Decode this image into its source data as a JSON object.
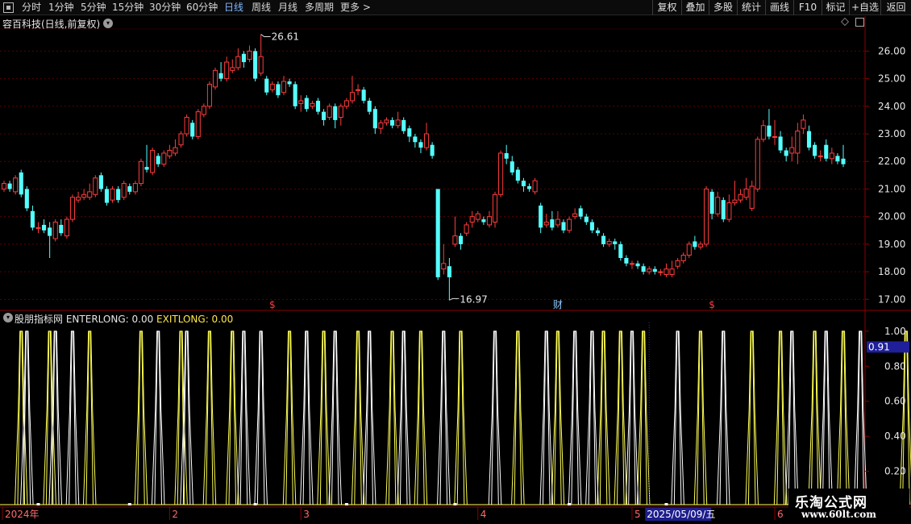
{
  "toolbar": {
    "tabs": [
      "分时",
      "1分钟",
      "5分钟",
      "15分钟",
      "30分钟",
      "60分钟",
      "日线",
      "周线",
      "月线",
      "多周期",
      "更多 >"
    ],
    "active_tab": "日线",
    "buttons": [
      "复权",
      "叠加",
      "多股",
      "统计",
      "画线",
      "F10",
      "标记",
      "+自选",
      "返回"
    ]
  },
  "main_chart": {
    "title": "容百科技(日线,前复权)",
    "y_ticks": [
      "26.00",
      "25.00",
      "24.00",
      "23.00",
      "22.00",
      "21.00",
      "20.00",
      "19.00",
      "18.00",
      "17.00"
    ],
    "high_label": "26.61",
    "low_label": "16.97",
    "markers": [
      "$",
      "财",
      "$"
    ]
  },
  "indicator": {
    "name": "股朋指标网",
    "enterlong": "ENTERLONG: 0.00",
    "exitlong": "EXITLONG: 0.00",
    "y_ticks": [
      "1.00",
      "0.80",
      "0.60",
      "0.40",
      "0.20"
    ],
    "current_value": "0.91"
  },
  "date_axis": {
    "labels": [
      "2024年",
      "2",
      "3",
      "4",
      "5",
      "6"
    ],
    "highlight": "2025/05/09/五"
  },
  "colors": {
    "up": "#ff3c3c",
    "down": "#54ffff",
    "enter": "#ffff55",
    "exit": "#ffffff",
    "grid": "#5a0000",
    "panel_border": "#8b0000"
  },
  "watermark": {
    "line1": "乐淘公式网",
    "line2": "www.60lt.com"
  },
  "chart_data": [
    {
      "type": "candlestick",
      "title": "容百科技(日线,前复权)",
      "ylim": [
        16.6,
        26.8
      ],
      "candles": [
        [
          21.0,
          21.2,
          21.3,
          20.9
        ],
        [
          21.2,
          21.0,
          21.3,
          20.9
        ],
        [
          20.9,
          21.4,
          21.5,
          20.8
        ],
        [
          21.6,
          20.8,
          21.7,
          20.7
        ],
        [
          21.0,
          20.3,
          21.1,
          20.2
        ],
        [
          20.2,
          19.6,
          20.4,
          19.5
        ],
        [
          19.6,
          19.6,
          19.8,
          19.4
        ],
        [
          19.7,
          19.5,
          19.9,
          19.4
        ],
        [
          19.6,
          19.3,
          19.8,
          18.5
        ],
        [
          19.2,
          19.8,
          19.9,
          19.1
        ],
        [
          19.7,
          19.4,
          19.9,
          19.3
        ],
        [
          19.3,
          19.9,
          20.0,
          19.2
        ],
        [
          19.9,
          20.7,
          20.8,
          19.8
        ],
        [
          20.6,
          20.7,
          20.9,
          20.5
        ],
        [
          20.7,
          20.8,
          21.0,
          20.6
        ],
        [
          20.7,
          20.9,
          21.2,
          20.6
        ],
        [
          20.8,
          21.4,
          21.5,
          20.7
        ],
        [
          21.5,
          21.0,
          21.6,
          20.9
        ],
        [
          21.0,
          20.5,
          21.1,
          20.4
        ],
        [
          20.6,
          21.0,
          21.1,
          20.5
        ],
        [
          21.0,
          20.6,
          21.1,
          20.5
        ],
        [
          20.7,
          21.2,
          21.3,
          20.6
        ],
        [
          21.1,
          20.9,
          21.2,
          20.8
        ],
        [
          20.9,
          21.2,
          21.3,
          20.8
        ],
        [
          21.2,
          22.0,
          22.1,
          21.1
        ],
        [
          21.8,
          21.7,
          22.6,
          21.6
        ],
        [
          21.6,
          22.4,
          22.5,
          21.5
        ],
        [
          22.2,
          21.9,
          22.3,
          21.8
        ],
        [
          21.9,
          22.3,
          22.4,
          21.8
        ],
        [
          22.2,
          22.4,
          22.6,
          22.1
        ],
        [
          22.3,
          22.5,
          22.8,
          22.2
        ],
        [
          22.6,
          23.0,
          23.1,
          22.5
        ],
        [
          23.0,
          23.6,
          23.7,
          22.9
        ],
        [
          23.4,
          22.9,
          23.5,
          22.8
        ],
        [
          22.9,
          23.8,
          23.9,
          22.8
        ],
        [
          23.7,
          24.0,
          24.1,
          23.6
        ],
        [
          24.0,
          24.8,
          24.9,
          23.9
        ],
        [
          24.7,
          25.3,
          25.4,
          24.6
        ],
        [
          25.2,
          25.0,
          25.6,
          24.9
        ],
        [
          25.0,
          25.6,
          25.8,
          24.9
        ],
        [
          25.3,
          25.4,
          25.7,
          25.2
        ],
        [
          25.4,
          25.8,
          26.1,
          25.3
        ],
        [
          25.9,
          25.6,
          26.0,
          25.4
        ],
        [
          25.7,
          26.0,
          26.2,
          25.6
        ],
        [
          26.0,
          25.0,
          26.1,
          24.9
        ],
        [
          25.2,
          25.8,
          26.61,
          25.1
        ],
        [
          25.0,
          24.5,
          25.1,
          24.4
        ],
        [
          24.6,
          24.8,
          24.9,
          24.5
        ],
        [
          24.8,
          24.4,
          24.9,
          24.3
        ],
        [
          24.5,
          24.9,
          25.1,
          24.4
        ],
        [
          24.9,
          24.8,
          25.0,
          24.7
        ],
        [
          24.8,
          24.0,
          24.9,
          23.9
        ],
        [
          24.1,
          24.2,
          24.4,
          23.8
        ],
        [
          24.3,
          23.9,
          24.4,
          23.8
        ],
        [
          24.0,
          24.1,
          24.2,
          23.9
        ],
        [
          24.2,
          23.8,
          24.3,
          23.7
        ],
        [
          23.8,
          23.5,
          23.9,
          23.3
        ],
        [
          23.6,
          24.0,
          24.1,
          23.5
        ],
        [
          24.0,
          23.5,
          24.1,
          23.2
        ],
        [
          23.6,
          24.0,
          24.1,
          23.3
        ],
        [
          24.0,
          24.2,
          24.3,
          23.9
        ],
        [
          24.2,
          24.5,
          25.1,
          24.1
        ],
        [
          24.6,
          24.6,
          24.8,
          24.4
        ],
        [
          24.6,
          24.2,
          24.7,
          24.1
        ],
        [
          24.2,
          23.8,
          24.3,
          23.7
        ],
        [
          23.9,
          23.2,
          24.0,
          23.0
        ],
        [
          23.2,
          23.4,
          23.5,
          23.0
        ],
        [
          23.4,
          23.5,
          23.6,
          23.3
        ],
        [
          23.5,
          23.3,
          23.6,
          23.2
        ],
        [
          23.3,
          23.5,
          23.8,
          23.2
        ],
        [
          23.5,
          23.1,
          23.6,
          23.0
        ],
        [
          23.2,
          22.9,
          23.3,
          22.7
        ],
        [
          22.9,
          22.7,
          23.0,
          22.5
        ],
        [
          22.7,
          22.5,
          22.8,
          22.3
        ],
        [
          22.5,
          23.0,
          23.4,
          22.4
        ],
        [
          22.6,
          22.2,
          22.7,
          22.1
        ],
        [
          21.0,
          17.8,
          21.0,
          17.7
        ],
        [
          18.1,
          18.3,
          19.0,
          17.9
        ],
        [
          18.2,
          17.8,
          18.5,
          16.97
        ],
        [
          19.0,
          19.3,
          20.0,
          18.9
        ],
        [
          19.3,
          19.0,
          19.4,
          18.8
        ],
        [
          19.4,
          19.7,
          19.8,
          19.3
        ],
        [
          19.8,
          20.0,
          20.2,
          19.6
        ],
        [
          19.9,
          20.1,
          20.2,
          19.8
        ],
        [
          19.9,
          19.8,
          20.0,
          19.7
        ],
        [
          19.7,
          20.0,
          20.2,
          19.6
        ],
        [
          19.8,
          20.8,
          20.9,
          19.6
        ],
        [
          20.8,
          22.3,
          22.4,
          20.7
        ],
        [
          22.3,
          22.1,
          22.6,
          21.9
        ],
        [
          22.0,
          21.6,
          22.2,
          21.5
        ],
        [
          21.7,
          21.3,
          21.8,
          21.2
        ],
        [
          21.3,
          21.1,
          21.4,
          20.9
        ],
        [
          21.1,
          21.0,
          21.2,
          20.9
        ],
        [
          20.9,
          21.3,
          21.4,
          20.8
        ],
        [
          20.4,
          19.6,
          20.5,
          19.4
        ],
        [
          19.7,
          19.8,
          20.1,
          19.6
        ],
        [
          19.9,
          19.6,
          20.2,
          19.5
        ],
        [
          19.7,
          19.9,
          20.2,
          19.6
        ],
        [
          19.8,
          19.5,
          19.9,
          19.4
        ],
        [
          19.5,
          19.9,
          20.0,
          19.4
        ],
        [
          20.0,
          20.1,
          20.3,
          19.9
        ],
        [
          20.3,
          20.0,
          20.4,
          19.9
        ],
        [
          20.0,
          19.8,
          20.1,
          19.7
        ],
        [
          19.8,
          19.5,
          19.9,
          19.4
        ],
        [
          19.5,
          19.4,
          19.6,
          19.3
        ],
        [
          19.3,
          19.0,
          19.4,
          18.9
        ],
        [
          19.0,
          19.1,
          19.2,
          18.9
        ],
        [
          19.1,
          19.0,
          19.2,
          18.8
        ],
        [
          19.0,
          18.5,
          19.1,
          18.4
        ],
        [
          18.5,
          18.3,
          18.6,
          18.2
        ],
        [
          18.3,
          18.3,
          18.4,
          18.1
        ],
        [
          18.3,
          18.2,
          18.4,
          18.1
        ],
        [
          18.2,
          18.0,
          18.3,
          17.9
        ],
        [
          18.0,
          18.1,
          18.2,
          17.9
        ],
        [
          18.1,
          18.0,
          18.2,
          17.9
        ],
        [
          18.0,
          18.0,
          18.1,
          17.85
        ],
        [
          17.9,
          18.1,
          18.3,
          17.8
        ],
        [
          17.9,
          18.1,
          18.4,
          17.8
        ],
        [
          18.2,
          18.4,
          18.5,
          18.1
        ],
        [
          18.4,
          18.6,
          18.7,
          18.3
        ],
        [
          18.6,
          19.0,
          19.1,
          18.5
        ],
        [
          19.1,
          18.9,
          19.3,
          18.8
        ],
        [
          18.9,
          19.0,
          19.1,
          18.8
        ],
        [
          19.0,
          21.0,
          21.1,
          18.9
        ],
        [
          20.9,
          20.1,
          21.0,
          19.9
        ],
        [
          20.1,
          20.7,
          20.9,
          20.0
        ],
        [
          20.6,
          19.9,
          20.7,
          19.8
        ],
        [
          19.9,
          20.5,
          20.8,
          19.8
        ],
        [
          20.5,
          20.6,
          21.3,
          20.4
        ],
        [
          20.6,
          20.8,
          21.0,
          20.5
        ],
        [
          20.7,
          21.0,
          21.4,
          20.6
        ],
        [
          20.3,
          21.1,
          21.3,
          20.2
        ],
        [
          21.0,
          22.8,
          22.9,
          20.9
        ],
        [
          22.8,
          23.3,
          23.5,
          22.7
        ],
        [
          23.3,
          22.9,
          23.9,
          22.8
        ],
        [
          22.9,
          22.9,
          23.5,
          22.6
        ],
        [
          22.9,
          22.4,
          23.1,
          22.3
        ],
        [
          22.4,
          22.2,
          22.5,
          22.0
        ],
        [
          22.3,
          22.5,
          22.9,
          22.0
        ],
        [
          22.3,
          23.1,
          23.4,
          21.9
        ],
        [
          23.2,
          23.5,
          23.7,
          23.0
        ],
        [
          23.1,
          22.5,
          23.3,
          22.4
        ],
        [
          22.6,
          22.2,
          22.7,
          22.1
        ],
        [
          22.2,
          22.2,
          22.4,
          22.0
        ],
        [
          22.6,
          22.1,
          22.8,
          22.0
        ],
        [
          22.1,
          22.3,
          22.5,
          21.9
        ],
        [
          22.2,
          22.0,
          22.3,
          21.9
        ],
        [
          22.1,
          21.9,
          22.6,
          21.8
        ]
      ]
    },
    {
      "type": "line",
      "title": "股朋指标网",
      "ylim": [
        0,
        1.05
      ],
      "series": [
        {
          "name": "ENTERLONG",
          "events": [
            3,
            8,
            15,
            24,
            31,
            36,
            40,
            50,
            56,
            62,
            68,
            73,
            80,
            90,
            97,
            105,
            108,
            112,
            122,
            131,
            136,
            142,
            147,
            158,
            162,
            165,
            168
          ]
        },
        {
          "name": "EXITLONG",
          "events": [
            4,
            9,
            12,
            27,
            32,
            42,
            45,
            53,
            58,
            64,
            70,
            77,
            86,
            95,
            100,
            103,
            110,
            118,
            126,
            138,
            144,
            150,
            160,
            164,
            167
          ]
        }
      ]
    }
  ]
}
